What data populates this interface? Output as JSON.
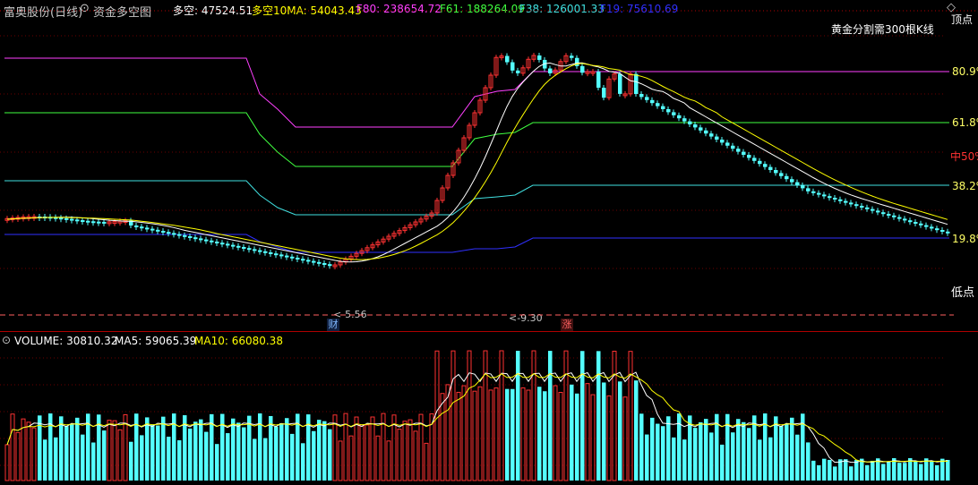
{
  "header": {
    "stock_name": "富奥股份(日线)",
    "indicator_name": "资金多空图",
    "series": [
      {
        "label": "多空: 47524.51",
        "color": "#ffffff"
      },
      {
        "label": "多空10MA: 54043.43",
        "color": "#ffff00"
      },
      {
        "label": "F80: 238654.72",
        "color": "#ff40ff"
      },
      {
        "label": "F61: 188264.09",
        "color": "#40ff40"
      },
      {
        "label": "F38: 126001.33",
        "color": "#40e0e0"
      },
      {
        "label": "F19: 75610.69",
        "color": "#3030ff"
      }
    ],
    "top_right_label": "顶点",
    "note": "黄金分割需300根K线"
  },
  "levels": {
    "f80": "80.9%",
    "f61": "61.8%",
    "mid": "中50%",
    "f38": "38.2%",
    "f19": "19.8%",
    "low": "低点"
  },
  "markers": {
    "arrow1": "<-5.56",
    "arrow2": "<-9.30",
    "badge_cai": "财",
    "badge_zhang": "涨"
  },
  "volume": {
    "label": "VOLUME: 30810.32",
    "ma5": "MA5: 59065.39",
    "ma10": "MA10: 66080.38"
  },
  "colors": {
    "up": "#ff3232",
    "down": "#54ffff",
    "f80": "#ff40ff",
    "f61": "#40ff40",
    "f38": "#40e0e0",
    "f19": "#3030ff",
    "ma_white": "#ffffff",
    "ma_yellow": "#ffff00",
    "text_red": "#ff3232",
    "text_yellow": "#ffff66"
  },
  "icons": {
    "menu": "circle-chevron-icon",
    "corner": "diamond-icon"
  }
}
